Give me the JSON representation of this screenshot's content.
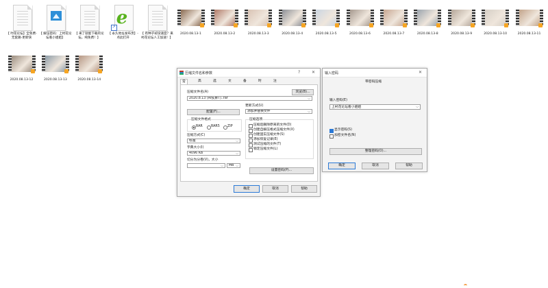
{
  "desktop": {
    "files": [
      {
        "kind": "doc",
        "label": "【 时花论坛】全免费-无套路-更新快"
      },
      {
        "kind": "image",
        "label": "【 解压密码：上村花论坛看小姐姐】"
      },
      {
        "kind": "doc",
        "label": "【 来了就能下载的论坛，纯免费！】"
      },
      {
        "kind": "ie",
        "label": "【 永久地址发布页】-点此打开"
      },
      {
        "kind": "doc",
        "label": "【 有种子却没速度？来村花论坛人工加速！】"
      },
      {
        "kind": "video",
        "label": "2020.08.13-1",
        "frame": "#8a6b52"
      },
      {
        "kind": "video",
        "label": "2020.08.13-2",
        "frame": "#b07a68"
      },
      {
        "kind": "video",
        "label": "2020.08.13-3",
        "frame": "#d9c3b4"
      },
      {
        "kind": "video",
        "label": "2020.08.13-4",
        "frame": "#8c8f96"
      },
      {
        "kind": "video",
        "label": "2020.08.13-5",
        "frame": "#cbd6e2"
      },
      {
        "kind": "video",
        "label": "2020.08.13-6",
        "frame": "#a6998f"
      },
      {
        "kind": "video",
        "label": "2020.08.13-7",
        "frame": "#c7a791"
      },
      {
        "kind": "video",
        "label": "2020.08.13-8",
        "frame": "#9aa4ad"
      },
      {
        "kind": "video",
        "label": "2020.08.13-9",
        "frame": "#b5a79a"
      },
      {
        "kind": "video",
        "label": "2020.08.13-10",
        "frame": "#d6cfc6"
      },
      {
        "kind": "video",
        "label": "2020.08.13-11",
        "frame": "#c2a48a"
      },
      {
        "kind": "video",
        "label": "2020.08.13-12",
        "frame": "#9b8d7f"
      },
      {
        "kind": "video",
        "label": "2020.08.13-13",
        "frame": "#8d9ca8"
      },
      {
        "kind": "video",
        "label": "2020.08.13-14",
        "frame": "#b69784"
      }
    ]
  },
  "archive_dialog": {
    "title": "压缩文件名和参数",
    "help": "?",
    "close": "✕",
    "tabs": [
      "常规",
      "高级",
      "选项",
      "文件",
      "备份",
      "时间",
      "注释"
    ],
    "archive_name_label": "压缩文件名(A)",
    "browse_button": "浏览(B)...",
    "archive_name_value": "2020.8.13 (Ai技算T)..rar",
    "profiles_button": "配置(F)...",
    "update_mode_label": "更新方式(U)",
    "update_mode_value": "添加并替换文件",
    "format_group_label": "压缩文件格式",
    "formats": [
      "RAR",
      "RAR5",
      "ZIP"
    ],
    "method_label": "压缩方式(C)",
    "method_value": "标准",
    "dict_label": "字典大小(I)",
    "dict_value": "4096 KB",
    "split_label": "切分为分卷(V)，大小",
    "split_unit": "MB",
    "options_group_label": "压缩选项",
    "options": [
      "压缩后删除原来的文件(D)",
      "创建自解压格式压缩文件(X)",
      "创建固实压缩文件(S)",
      "添加恢复记录(E)",
      "测试压缩的文件(T)",
      "锁定压缩文件(L)"
    ],
    "set_password_button": "设置密码(P)...",
    "ok_button": "确定",
    "cancel_button": "取消",
    "help_button": "帮助"
  },
  "password_dialog": {
    "title": "输入密码",
    "close": "✕",
    "heading": "带密码压缩",
    "enter_password_label": "输入密码(E)",
    "password_value": "上村花论坛看小姐姐",
    "show_password_label": "显示密码(S)",
    "encrypt_names_label": "加密文件名(N)",
    "organize_button": "整理密码(O)...",
    "ok_button": "确定",
    "cancel_button": "取消",
    "help_button": "帮助"
  }
}
